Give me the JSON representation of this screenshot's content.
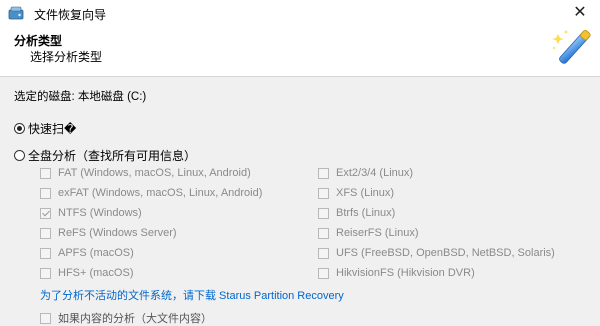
{
  "window": {
    "title": "文件恢复向导",
    "close": "✕"
  },
  "header": {
    "title": "分析类型",
    "subtitle": "选择分析类型"
  },
  "disk": {
    "label": "选定的磁盘: 本地磁盘 (C:)"
  },
  "options": {
    "quick": {
      "label": "快速扫�",
      "selected": true
    },
    "full": {
      "label": "全盘分析（查找所有可用信息）",
      "selected": false
    }
  },
  "filesystems": {
    "left": [
      {
        "label": "FAT (Windows, macOS, Linux, Android)",
        "checked": false
      },
      {
        "label": "exFAT (Windows, macOS, Linux, Android)",
        "checked": false
      },
      {
        "label": "NTFS (Windows)",
        "checked": true
      },
      {
        "label": "ReFS (Windows Server)",
        "checked": false
      },
      {
        "label": "APFS (macOS)",
        "checked": false
      },
      {
        "label": "HFS+ (macOS)",
        "checked": false
      }
    ],
    "right": [
      {
        "label": "Ext2/3/4 (Linux)",
        "checked": false
      },
      {
        "label": "XFS (Linux)",
        "checked": false
      },
      {
        "label": "Btrfs (Linux)",
        "checked": false
      },
      {
        "label": "ReiserFS (Linux)",
        "checked": false
      },
      {
        "label": "UFS (FreeBSD, OpenBSD, NetBSD, Solaris)",
        "checked": false
      },
      {
        "label": "HikvisionFS (Hikvision DVR)",
        "checked": false
      }
    ]
  },
  "link": {
    "text": "为了分析不活动的文件系统，请下载 Starus Partition Recovery"
  },
  "bottom": {
    "label": "如果内容的分析（大文件内容）"
  }
}
